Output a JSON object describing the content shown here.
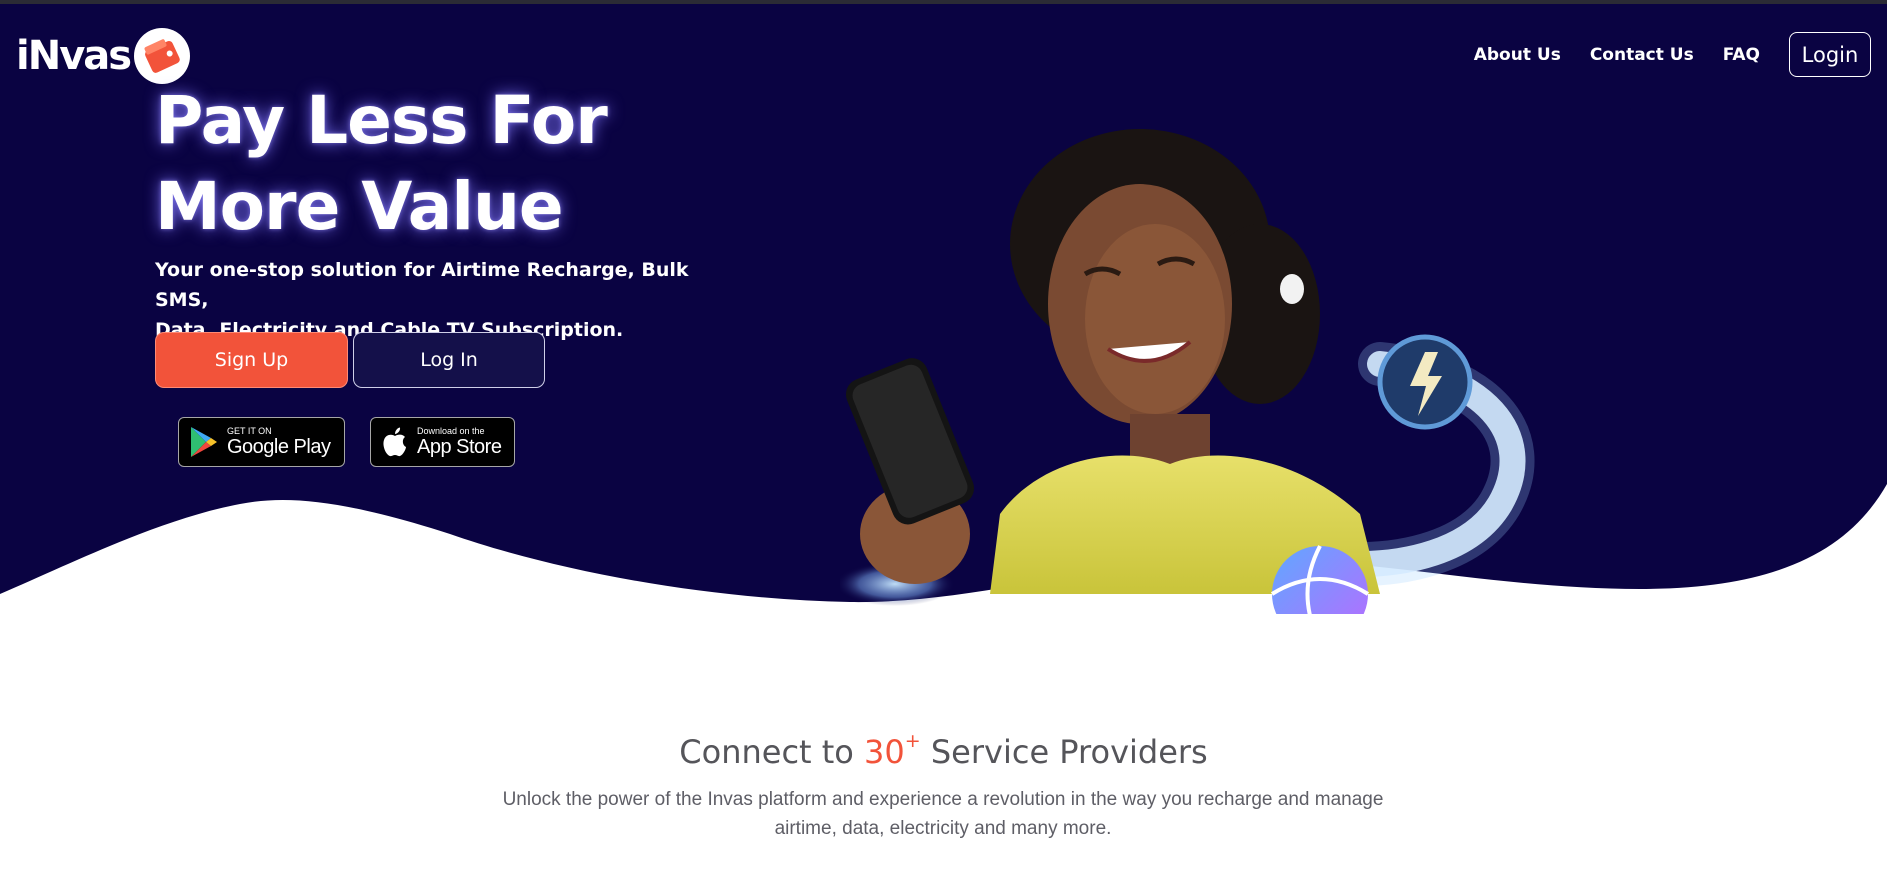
{
  "header": {
    "logo_text": "iNvas",
    "nav": [
      "About Us",
      "Contact Us",
      "FAQ"
    ],
    "login_label": "Login"
  },
  "hero": {
    "title_line1": "Pay Less For",
    "title_line2": "More Value",
    "subtitle_line1": "Your one-stop solution for Airtime Recharge, Bulk SMS,",
    "subtitle_line2": "Data, Electricity and Cable TV Subscription.",
    "signup_label": "Sign Up",
    "login_label": "Log In",
    "google_play": {
      "small": "GET IT ON",
      "big": "Google Play"
    },
    "app_store": {
      "small": "Download on the",
      "big": "App Store"
    }
  },
  "providers": {
    "title_prefix": "Connect to",
    "count": "30",
    "count_suffix": "+",
    "title_suffix": "Service Providers",
    "description_line1": "Unlock the power of the Invas platform and experience a revolution in the way you recharge and manage",
    "description_line2": "airtime, data, electricity and many more."
  },
  "colors": {
    "hero_bg": "#0a0342",
    "accent": "#f2533a",
    "text_gray": "#55555a"
  },
  "icons": [
    "wallet-logo-icon",
    "google-play-icon",
    "apple-icon",
    "lightning-icon"
  ]
}
